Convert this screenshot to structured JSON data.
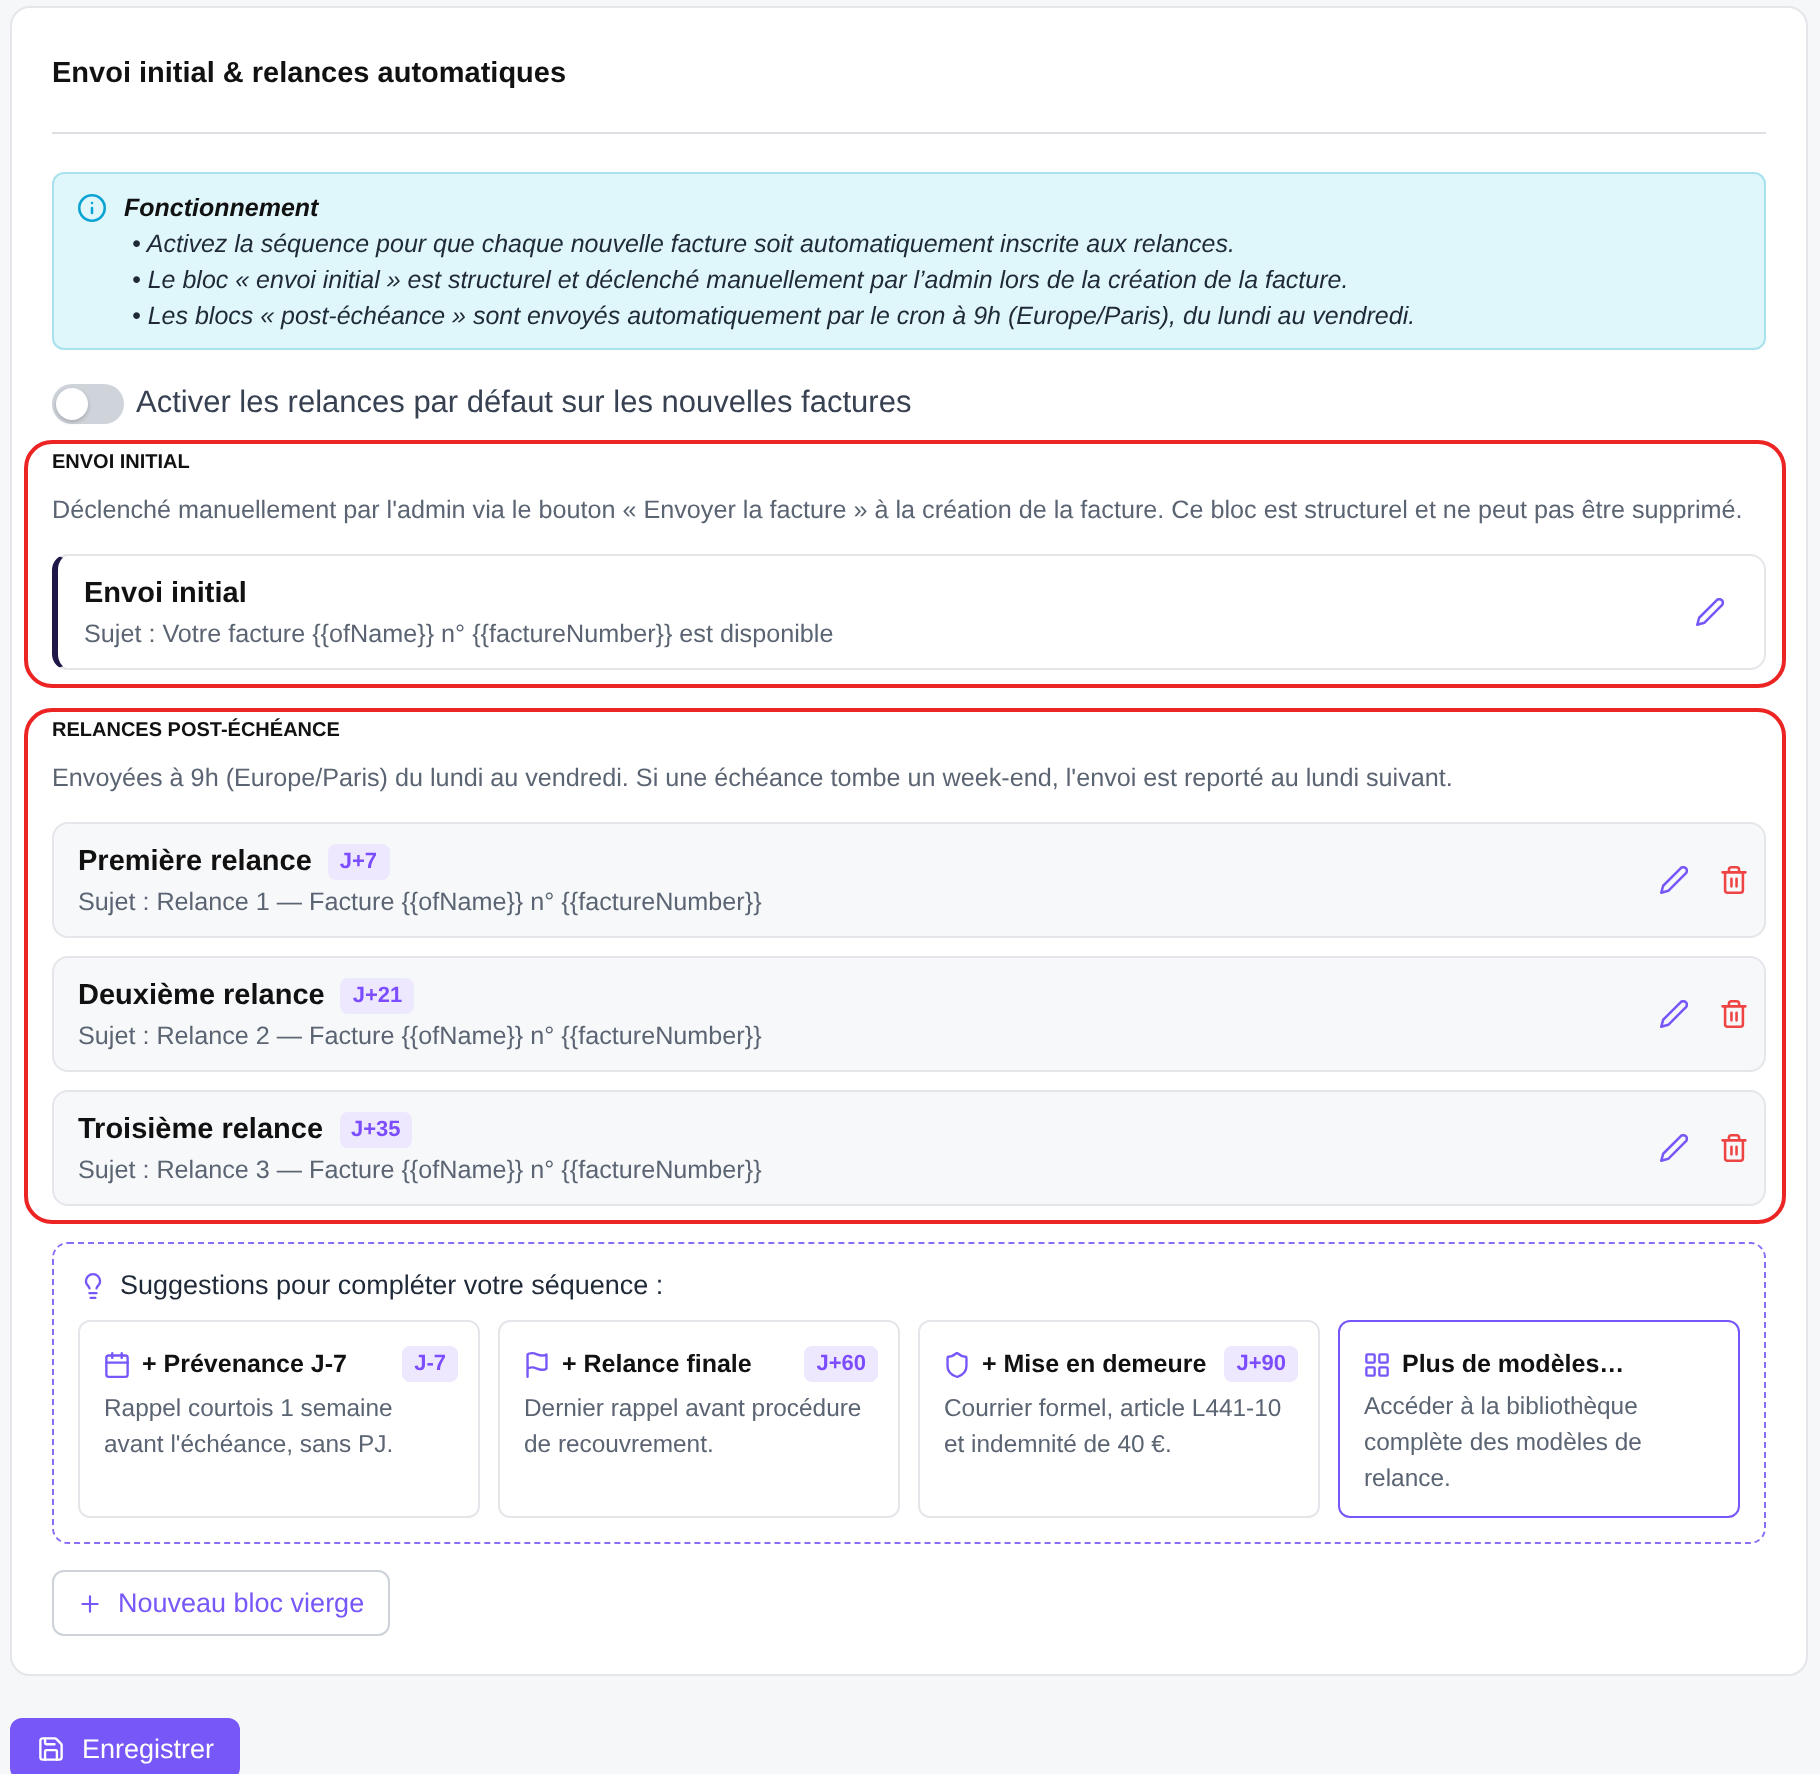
{
  "section": {
    "title": "Envoi initial & relances automatiques"
  },
  "info": {
    "title": "Fonctionnement",
    "bullets": [
      "• Activez la séquence pour que chaque nouvelle facture soit automatiquement inscrite aux relances.",
      "• Le bloc « envoi initial » est structurel et déclenché manuellement par l’admin lors de la création de la facture.",
      "• Les blocs « post-échéance » sont envoyés automatiquement par le cron à 9h (Europe/Paris), du lundi au vendredi."
    ]
  },
  "toggle": {
    "label": "Activer les relances par défaut sur les nouvelles factures",
    "on": false
  },
  "groups": [
    {
      "heading": "ENVOI INITIAL",
      "description": "Déclenché manuellement par l'admin via le bouton « Envoyer la facture » à la création de la facture. Ce bloc est structurel et ne peut pas être supprimé.",
      "highlighted": true,
      "blocks": [
        {
          "kind": "initial",
          "title": "Envoi initial",
          "subject": "Sujet : Votre facture {{ofName}} n° {{factureNumber}} est disponible"
        }
      ]
    },
    {
      "heading": "RELANCES POST-ÉCHÉANCE",
      "description": "Envoyées à 9h (Europe/Paris) du lundi au vendredi. Si une échéance tombe un week-end, l'envoi est reporté au lundi suivant.",
      "highlighted": true,
      "blocks": [
        {
          "kind": "reminder",
          "title": "Première relance",
          "badge": "J+7",
          "subject": "Sujet : Relance 1 — Facture {{ofName}} n° {{factureNumber}}"
        },
        {
          "kind": "reminder",
          "title": "Deuxième relance",
          "badge": "J+21",
          "subject": "Sujet : Relance 2 — Facture {{ofName}} n° {{factureNumber}}"
        },
        {
          "kind": "reminder",
          "title": "Troisième relance",
          "badge": "J+35",
          "subject": "Sujet : Relance 3 — Facture {{ofName}} n° {{factureNumber}}"
        }
      ]
    }
  ],
  "suggestions": {
    "title": "Suggestions pour compléter votre séquence :",
    "items": [
      {
        "kind": "template",
        "title": "+ Prévenance J-7",
        "badge": "J-7",
        "description": "Rappel courtois 1 semaine avant l'échéance, sans PJ."
      },
      {
        "kind": "template",
        "title": "+ Relance finale",
        "badge": "J+60",
        "description": "Dernier rappel avant procédure de recouvrement."
      },
      {
        "kind": "template",
        "title": "+ Mise en demeure",
        "badge": "J+90",
        "description": "Courrier formel, article L441-10 et indemnité de 40 €."
      },
      {
        "kind": "more",
        "title": "Plus de modèles…",
        "description": "Accéder à la bibliothèque complète des modèles de relance."
      }
    ]
  },
  "new_block_button": "Nouveau bloc vierge",
  "save_button": "Enregistrer"
}
